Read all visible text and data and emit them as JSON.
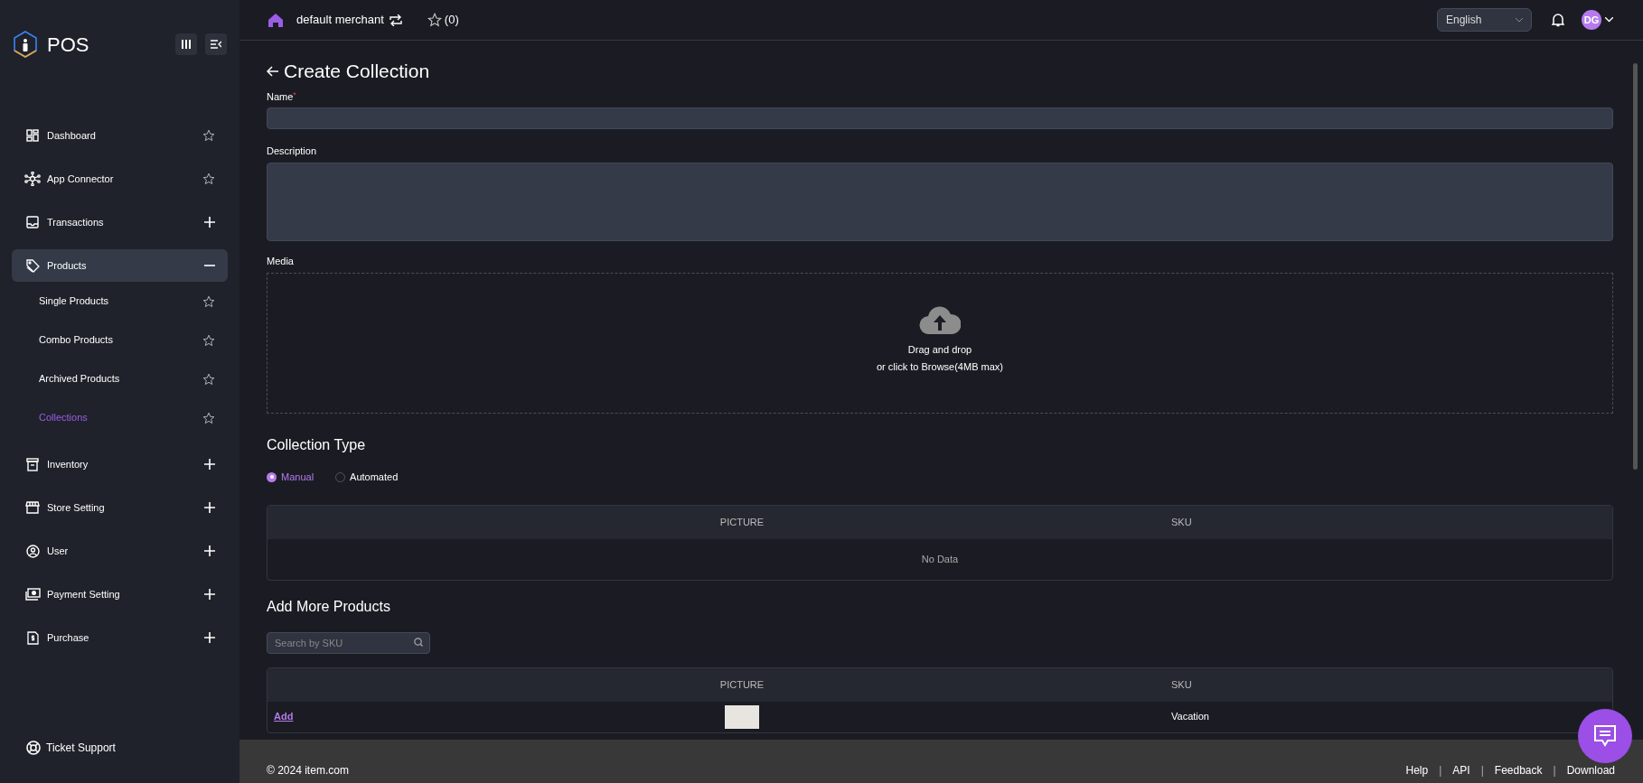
{
  "sidebar": {
    "logo": "POS",
    "items": [
      {
        "label": "Dashboard",
        "kind": "link",
        "selected": false
      },
      {
        "label": "App Connector",
        "kind": "link",
        "selected": false
      },
      {
        "label": "Transactions",
        "kind": "group",
        "expanded": false,
        "selected": false
      },
      {
        "label": "Products",
        "kind": "group",
        "expanded": true,
        "selected": true,
        "children": [
          {
            "label": "Single Products",
            "selected": false
          },
          {
            "label": "Combo Products",
            "selected": false
          },
          {
            "label": "Archived Products",
            "selected": false
          },
          {
            "label": "Collections",
            "selected": true
          }
        ]
      },
      {
        "label": "Inventory",
        "kind": "group",
        "expanded": false,
        "selected": false
      },
      {
        "label": "Store Setting",
        "kind": "group",
        "expanded": false,
        "selected": false
      },
      {
        "label": "User",
        "kind": "group",
        "expanded": false,
        "selected": false
      },
      {
        "label": "Payment Setting",
        "kind": "group",
        "expanded": false,
        "selected": false
      },
      {
        "label": "Purchase",
        "kind": "group",
        "expanded": false,
        "selected": false
      }
    ],
    "support": "Ticket Support"
  },
  "topbar": {
    "merchant": "default merchant",
    "favorites": "(0)",
    "language": "English",
    "avatar": "DG"
  },
  "page": {
    "title": "Create Collection",
    "name_field": {
      "label": "Name",
      "required_mark": "*"
    },
    "description_field": {
      "label": "Description"
    },
    "media": {
      "label": "Media",
      "line_1": "Drag and drop",
      "line_2": "or click to Browse(4MB max)"
    },
    "collection_type": {
      "heading": "Collection Type",
      "options": [
        {
          "label": "Manual",
          "selected": true
        },
        {
          "label": "Automated",
          "selected": false
        }
      ]
    },
    "selected_table": {
      "columns": [
        "PICTURE",
        "SKU"
      ],
      "empty_text": "No Data"
    },
    "add_more": {
      "heading": "Add More Products",
      "search": {
        "placeholder": "Search by SKU"
      },
      "table": {
        "columns": [
          "PICTURE",
          "SKU"
        ],
        "rows": [
          {
            "action": "Add",
            "sku": "Vacation"
          }
        ]
      }
    }
  },
  "footer": {
    "copyright": "© 2024 item.com",
    "links": [
      "Help",
      "API",
      "Feedback",
      "Download"
    ],
    "separators": [
      "|",
      "|",
      "|"
    ]
  }
}
